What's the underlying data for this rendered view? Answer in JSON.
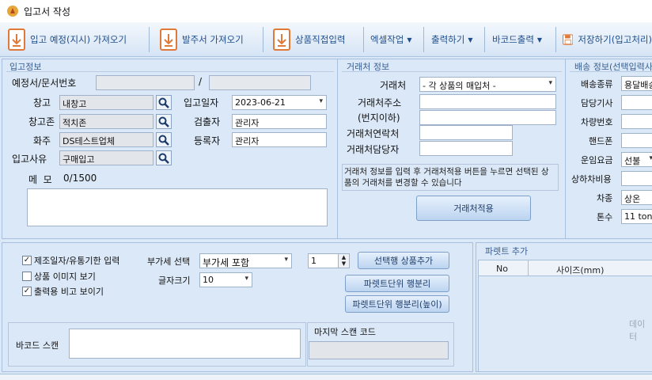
{
  "window": {
    "title": "입고서 작성"
  },
  "toolbar": {
    "import_plan": "입고 예정(지시) 가져오기",
    "import_order": "발주서 가져오기",
    "direct_input": "상품직접입력",
    "excel": "엑셀작업",
    "print": "출력하기",
    "barcode_print": "바코드출력",
    "save": "저장하기(입고처리)"
  },
  "receipt": {
    "section_title": "입고정보",
    "plan_no_label": "예정서/문서번호",
    "plan_no_sep": "/",
    "warehouse_label": "창고",
    "warehouse_value": "내창고",
    "zone_label": "창고존",
    "zone_value": "적치존",
    "owner_label": "화주",
    "owner_value": "DS테스트업체",
    "reason_label": "입고사유",
    "reason_value": "구매입고",
    "date_label": "입고일자",
    "date_value": "2023-06-21",
    "inspector_label": "검출자",
    "inspector_value": "관리자",
    "registrar_label": "등록자",
    "registrar_value": "관리자",
    "memo_label": "메  모",
    "memo_count": "0/1500"
  },
  "supplier": {
    "section_title": "거래처 정보",
    "name_label": "거래처",
    "name_value": "- 각 상품의 매입처 -",
    "address_label": "거래처주소",
    "address2_label": "(번지이하)",
    "contact_label": "거래처연락처",
    "manager_label": "거래처담당자",
    "note": "거래처 정보를 입력 후 거래처적용 버튼을 누르면 선택된 상품의 거래처를 변경할 수 있습니다",
    "apply_button": "거래처적용"
  },
  "shipping": {
    "section_title": "배송 정보(선택입력사항)",
    "type_label": "배송종류",
    "type_value": "용달배송",
    "driver_label": "담당기사",
    "vehicle_label": "차량번호",
    "phone_label": "핸드폰",
    "fare_label": "운임요금",
    "fare_value": "선불",
    "loading_label": "상하차비용",
    "car_type_label": "차종",
    "car_type_value": "상온",
    "tonnage_label": "톤수",
    "tonnage_value": "11 ton"
  },
  "options": {
    "mfg_date_label": "제조일자/유통기한 입력",
    "mfg_date_checked": true,
    "image_label": "상품 이미지 보기",
    "image_checked": false,
    "print_note_label": "출력용 비고 보이기",
    "print_note_checked": true,
    "vat_label": "부가세 선택",
    "vat_value": "부가세 포함",
    "font_size_label": "글자크기",
    "font_size_value": "10",
    "qty_value": "1",
    "add_row_button": "선택행 상품추가",
    "pallet_split_button": "파렛트단위 행분리",
    "pallet_split_height_button": "파렛트단위 행분리(높이)"
  },
  "barcode": {
    "scan_label": "바코드 스캔",
    "last_scan_label": "마지막 스캔 코드"
  },
  "pallet": {
    "section_title": "파렛트 추가",
    "col_no": "No",
    "col_size": "사이즈(mm)",
    "empty_text": "데이터"
  },
  "colors": {
    "accent": "#1e4e8c",
    "icon_orange": "#e07a3a",
    "panel_bg": "#dbe8f7"
  }
}
